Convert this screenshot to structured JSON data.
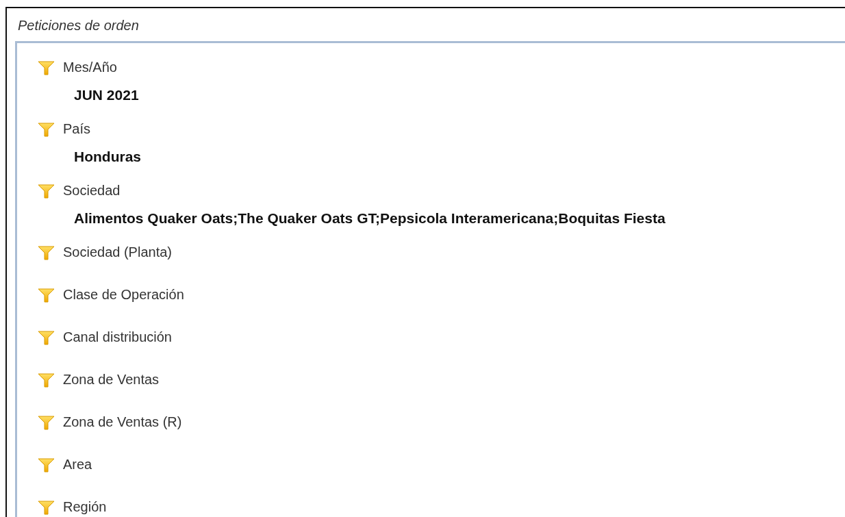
{
  "panel": {
    "title": "Peticiones de orden"
  },
  "filters": [
    {
      "label": "Mes/Año",
      "value": "JUN 2021"
    },
    {
      "label": "País",
      "value": "Honduras"
    },
    {
      "label": "Sociedad",
      "value": "Alimentos Quaker Oats;The Quaker Oats GT;Pepsicola Interamericana;Boquitas Fiesta"
    },
    {
      "label": "Sociedad (Planta)"
    },
    {
      "label": "Clase de Operación"
    },
    {
      "label": "Canal distribución"
    },
    {
      "label": "Zona de Ventas"
    },
    {
      "label": "Zona de Ventas (R)"
    },
    {
      "label": "Area"
    },
    {
      "label": "Región"
    }
  ]
}
